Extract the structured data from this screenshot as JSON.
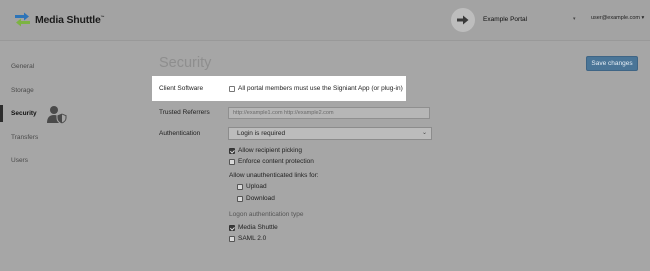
{
  "header": {
    "app_name": "Media Shuttle",
    "app_tm": "™",
    "portal_name": "Example Portal",
    "user_menu": "user@example.com ▾"
  },
  "sidebar": {
    "items": [
      {
        "label": "General"
      },
      {
        "label": "Storage"
      },
      {
        "label": "Security"
      },
      {
        "label": "Transfers"
      },
      {
        "label": "Users"
      }
    ]
  },
  "main": {
    "title": "Security",
    "save_button": "Save changes",
    "client_software": {
      "label": "Client Software",
      "checkbox_label": "All portal members must use the Signiant App (or plug-in)",
      "checked": false
    },
    "trusted_referrers": {
      "label": "Trusted Referrers",
      "placeholder": "http://example1.com http://example2.com"
    },
    "authentication": {
      "label": "Authentication",
      "selected": "Login is required",
      "options": [
        {
          "label": "Allow recipient picking",
          "checked": true
        },
        {
          "label": "Enforce content protection",
          "checked": false
        }
      ],
      "unauth_heading": "Allow unauthenticated links for:",
      "unauth_options": [
        {
          "label": "Upload",
          "checked": false
        },
        {
          "label": "Download",
          "checked": false
        }
      ],
      "logon_heading": "Logon authentication type",
      "logon_options": [
        {
          "label": "Media Shuttle",
          "checked": true
        },
        {
          "label": "SAML 2.0",
          "checked": false
        }
      ]
    }
  },
  "colors": {
    "overlay_gray": "#a6a6a6",
    "highlight": "#ffffff",
    "save_button": "#4a7597",
    "logo_blue": "#2d74b8",
    "logo_green": "#7cb342"
  }
}
